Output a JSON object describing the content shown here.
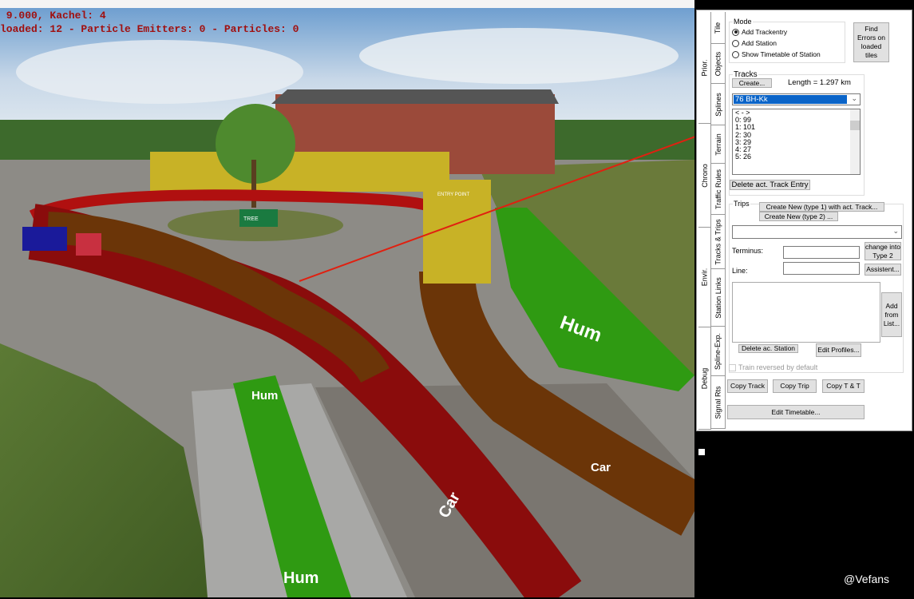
{
  "hud": {
    "line1": " 9.000, Kachel: 4",
    "line2": "loaded: 12 - Particle Emitters: 0 - Particles: 0"
  },
  "scene": {
    "road_labels": [
      "Hum",
      "Car",
      "Hum",
      "Car"
    ],
    "sign_labels": [
      "ENTRY POINT",
      "TREE",
      "TREE"
    ]
  },
  "tabs": {
    "outer": [
      "Prior.",
      "Chrono",
      "Envir.",
      "Debug"
    ],
    "inner": [
      "Tile",
      "Objects",
      "Splines",
      "Terrain",
      "Traffic Rules",
      "Tracks & Trips",
      "Station Links",
      "Spline-Exp.",
      "Signal Rts"
    ]
  },
  "mode": {
    "title": "Mode",
    "options": [
      "Add Trackentry",
      "Add Station",
      "Show Timetable of Station"
    ],
    "selected": 0
  },
  "find_errors": "Find Errors on loaded tiles",
  "tracks": {
    "title": "Tracks",
    "create": "Create...",
    "length": "Length = 1.297 km",
    "selected": "76  BH-Kk",
    "list": [
      "< - >",
      "0: 99",
      "1: 101",
      "2: 30",
      "3: 29",
      "4: 27",
      "5: 26"
    ],
    "delete": "Delete act. Track Entry"
  },
  "trips": {
    "title": "Trips",
    "create1": "Create New  (type 1) with act. Track...",
    "create2": "Create New  (type 2) ...",
    "dropdown": "",
    "terminus_label": "Terminus:",
    "terminus_value": "",
    "line_label": "Line:",
    "line_value": "",
    "change": "change into Type 2",
    "assistent": "Assistent...",
    "add_from_list": "Add from List...",
    "delete_station": "Delete ac. Station",
    "edit_profiles": "Edit Profiles...",
    "reversed": "Train reversed by default"
  },
  "copy_track": "Copy Track",
  "copy_trip": "Copy Trip",
  "copy_tt": "Copy T & T",
  "edit_timetable": "Edit Timetable...",
  "watermark": "@Vefans"
}
